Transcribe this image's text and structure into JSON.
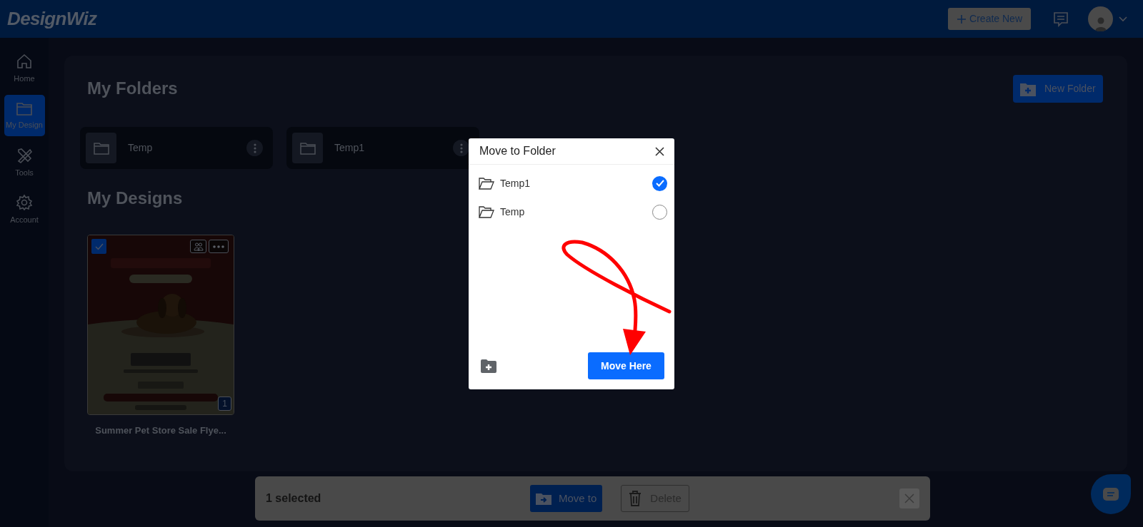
{
  "header": {
    "logo": "DesignWiz",
    "create_button": "Create New"
  },
  "sidebar": {
    "items": [
      {
        "label": "Home",
        "kind": "home",
        "selected": false
      },
      {
        "label": "My Design",
        "kind": "folder",
        "selected": true
      },
      {
        "label": "Tools",
        "kind": "tools",
        "selected": false
      },
      {
        "label": "Account",
        "kind": "gear",
        "selected": false
      }
    ]
  },
  "folders_section": {
    "title": "My Folders",
    "new_folder_button": "New Folder",
    "folders": [
      {
        "name": "Temp"
      },
      {
        "name": "Temp1"
      }
    ]
  },
  "designs_section": {
    "title": "My Designs",
    "designs": [
      {
        "name": "Summer Pet Store Sale Flye...",
        "selected": true,
        "page_count": "1"
      }
    ]
  },
  "selection_bar": {
    "count": "1 selected",
    "move_button": "Move to",
    "delete_button": "Delete"
  },
  "dialog": {
    "title": "Move to Folder",
    "folders": [
      {
        "name": "Temp1",
        "selected": true
      },
      {
        "name": "Temp",
        "selected": false
      }
    ],
    "confirm_button": "Move Here"
  }
}
